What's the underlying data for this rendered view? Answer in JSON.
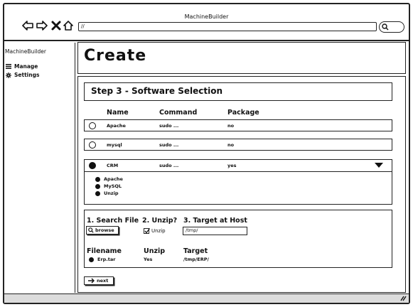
{
  "window": {
    "title": "MachineBuilder",
    "url": "//"
  },
  "sidebar": {
    "brand": "MachineBuilder",
    "items": [
      {
        "label": "Manage",
        "icon": "list-icon"
      },
      {
        "label": "Settings",
        "icon": "gear-icon"
      }
    ]
  },
  "main": {
    "title": "Create",
    "step_title": "Step 3 - Software Selection",
    "columns": {
      "name": "Name",
      "command": "Command",
      "package": "Package"
    },
    "rows": [
      {
        "name": "Apache",
        "command": "sudo ...",
        "package": "no",
        "selected": false
      },
      {
        "name": "mysql",
        "command": "sudo ...",
        "package": "no",
        "selected": false
      },
      {
        "name": "CRM",
        "command": "sudo ...",
        "package": "yes",
        "selected": true
      }
    ],
    "crm_components": [
      "Apache",
      "MySQL",
      "Unzip"
    ],
    "upload": {
      "search_label": "1. Search File",
      "unzip_label": "2. Unzip?",
      "target_label": "3. Target at Host",
      "browse_label": "browse",
      "unzip_checkbox_label": "Unzip",
      "unzip_checked": true,
      "target_value": "/tmp/",
      "file_headers": {
        "filename": "Filename",
        "unzip": "Unzip",
        "target": "Target"
      },
      "file": {
        "name": "Erp.tar",
        "unzip": "Yes",
        "target": "/tmp/ERP/"
      }
    },
    "next_label": "next"
  }
}
